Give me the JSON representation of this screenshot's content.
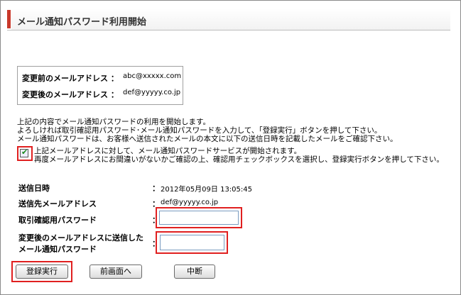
{
  "page": {
    "title": "メール通知パスワード利用開始"
  },
  "addresses": {
    "before_label": "変更前のメールアドレス ：",
    "before_value": "abc@xxxxx.com",
    "after_label": "変更後のメールアドレス ：",
    "after_value": "def@yyyyy.co.jp"
  },
  "messages": {
    "line1": "上記の内容でメール通知パスワードの利用を開始します。",
    "line2": "よろしければ取引確認用パスワード･メール通知パスワードを入力して、「登録実行」ボタンを押して下さい。",
    "line3": "メール通知パスワードは、お客様へ送信されたメールの本文に以下の送信日時を記載したメールをご確認下さい。",
    "confirm1": "上記メールアドレスに対して、メール通知パスワードサービスが開始されます。",
    "confirm2": "再度メールアドレスにお間違いがないかご確認の上、確認用チェックボックスを選択し、登録実行ボタンを押して下さい。"
  },
  "confirm_checkbox": {
    "checked": true
  },
  "form": {
    "send_datetime_label": "送信日時",
    "send_datetime_value": "2012年05月09日 13:05:45",
    "send_address_label": "送信先メールアドレス",
    "send_address_value": "def@yyyyy.co.jp",
    "trade_password_label": "取引確認用パスワード",
    "mail_password_label_1": "変更後のメールアドレスに送信した",
    "mail_password_label_2": "メール通知パスワード",
    "colon": "："
  },
  "buttons": {
    "register": "登録実行",
    "back": "前画面へ",
    "cancel": "中断"
  },
  "colors": {
    "highlight": "#e02020",
    "title_mark": "#c9392b"
  }
}
